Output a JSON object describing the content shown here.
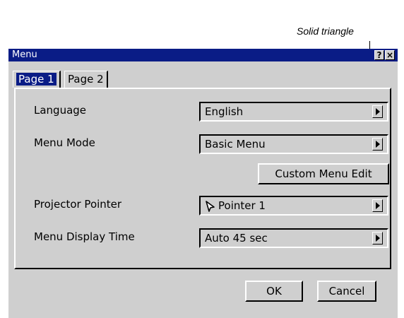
{
  "annotation": {
    "text": "Solid triangle"
  },
  "window": {
    "title": "Menu",
    "title_buttons": {
      "help": "?",
      "close": "×"
    }
  },
  "tabs": [
    {
      "label": "Page 1",
      "active": true
    },
    {
      "label": "Page 2",
      "active": false
    }
  ],
  "settings": [
    {
      "label": "Language",
      "value": "English"
    },
    {
      "label": "Menu Mode",
      "value": "Basic Menu"
    },
    {
      "label": "Projector Pointer",
      "value": "Pointer 1",
      "icon": "pointer-icon"
    },
    {
      "label": "Menu Display Time",
      "value": "Auto 45 sec"
    }
  ],
  "buttons": {
    "custom_menu_edit": "Custom Menu Edit",
    "ok": "OK",
    "cancel": "Cancel"
  },
  "colors": {
    "titlebar": "#0a1c86",
    "window_bg": "#cfcfcf",
    "selected_tab_bg": "#0a1c86"
  }
}
